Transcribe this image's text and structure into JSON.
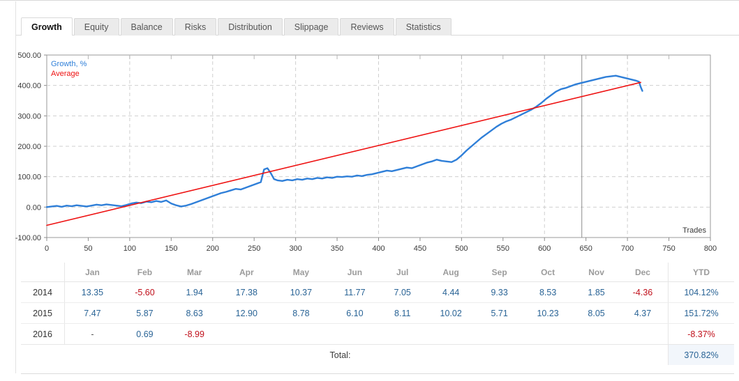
{
  "tabs": [
    {
      "label": "Growth",
      "active": true
    },
    {
      "label": "Equity",
      "active": false
    },
    {
      "label": "Balance",
      "active": false
    },
    {
      "label": "Risks",
      "active": false
    },
    {
      "label": "Distribution",
      "active": false
    },
    {
      "label": "Slippage",
      "active": false
    },
    {
      "label": "Reviews",
      "active": false
    },
    {
      "label": "Statistics",
      "active": false
    }
  ],
  "chart_data": {
    "type": "line",
    "title": "",
    "xlabel": "Trades",
    "ylabel": "",
    "xlim": [
      0,
      800
    ],
    "ylim": [
      -100,
      500
    ],
    "xticks": [
      0,
      50,
      100,
      150,
      200,
      250,
      300,
      350,
      400,
      450,
      500,
      550,
      600,
      650,
      700,
      750,
      800
    ],
    "yticks": [
      -100,
      0,
      100,
      200,
      300,
      400,
      500
    ],
    "ytick_labels": [
      "-100.00",
      "0.00",
      "100.00",
      "200.00",
      "300.00",
      "400.00",
      "500.00"
    ],
    "grid": true,
    "legend_position": "top-left",
    "marker_line_x": 645,
    "colors": {
      "growth": "#2f7fd8",
      "average": "#ee1111",
      "grid": "#cfcfcf",
      "axis": "#808080"
    },
    "series": [
      {
        "name": "Growth, %",
        "color": "#2f7fd8",
        "x": [
          0,
          6,
          12,
          18,
          24,
          30,
          36,
          42,
          48,
          54,
          60,
          66,
          72,
          78,
          84,
          90,
          96,
          102,
          108,
          114,
          120,
          126,
          132,
          138,
          144,
          150,
          156,
          162,
          168,
          174,
          180,
          186,
          192,
          198,
          204,
          210,
          216,
          222,
          228,
          234,
          240,
          246,
          252,
          258,
          262,
          266,
          270,
          274,
          278,
          284,
          290,
          296,
          302,
          308,
          314,
          320,
          326,
          332,
          338,
          344,
          350,
          356,
          362,
          368,
          374,
          380,
          386,
          392,
          398,
          404,
          410,
          416,
          422,
          428,
          434,
          440,
          446,
          452,
          458,
          464,
          470,
          476,
          482,
          488,
          494,
          500,
          506,
          512,
          518,
          524,
          530,
          536,
          542,
          548,
          554,
          560,
          566,
          572,
          578,
          584,
          590,
          596,
          602,
          608,
          614,
          620,
          626,
          632,
          638,
          644,
          650,
          656,
          662,
          668,
          674,
          680,
          686,
          692,
          698,
          704,
          710,
          714,
          716,
          718
        ],
        "y": [
          0,
          2,
          4,
          1,
          5,
          3,
          6,
          4,
          2,
          5,
          8,
          6,
          9,
          7,
          5,
          3,
          7,
          12,
          15,
          13,
          18,
          16,
          20,
          17,
          22,
          12,
          6,
          2,
          5,
          10,
          16,
          22,
          28,
          34,
          40,
          46,
          50,
          55,
          60,
          58,
          64,
          70,
          76,
          82,
          124,
          128,
          112,
          92,
          88,
          86,
          90,
          88,
          92,
          90,
          94,
          92,
          96,
          94,
          98,
          96,
          100,
          99,
          101,
          100,
          104,
          102,
          106,
          108,
          112,
          116,
          120,
          118,
          122,
          126,
          130,
          128,
          134,
          140,
          146,
          150,
          156,
          152,
          150,
          148,
          156,
          170,
          186,
          200,
          214,
          228,
          240,
          252,
          264,
          274,
          282,
          288,
          296,
          304,
          312,
          320,
          330,
          342,
          356,
          368,
          380,
          388,
          392,
          398,
          404,
          408,
          412,
          416,
          420,
          424,
          428,
          430,
          432,
          428,
          424,
          420,
          416,
          412,
          395,
          382
        ]
      },
      {
        "name": "Average",
        "color": "#ee1111",
        "x": [
          0,
          716
        ],
        "y": [
          -60,
          410
        ]
      }
    ]
  },
  "table": {
    "columns": [
      "",
      "Jan",
      "Feb",
      "Mar",
      "Apr",
      "May",
      "Jun",
      "Jul",
      "Aug",
      "Sep",
      "Oct",
      "Nov",
      "Dec",
      "YTD"
    ],
    "rows": [
      {
        "year": "2014",
        "months": [
          "13.35",
          "-5.60",
          "1.94",
          "17.38",
          "10.37",
          "11.77",
          "7.05",
          "4.44",
          "9.33",
          "8.53",
          "1.85",
          "-4.36"
        ],
        "ytd": "104.12%"
      },
      {
        "year": "2015",
        "months": [
          "7.47",
          "5.87",
          "8.63",
          "12.90",
          "8.78",
          "6.10",
          "8.11",
          "10.02",
          "5.71",
          "10.23",
          "8.05",
          "4.37"
        ],
        "ytd": "151.72%"
      },
      {
        "year": "2016",
        "months": [
          "-",
          "0.69",
          "-8.99",
          "",
          "",
          "",
          "",
          "",
          "",
          "",
          "",
          ""
        ],
        "ytd": "-8.37%"
      }
    ],
    "total_label": "Total:",
    "total_value": "370.82%"
  }
}
